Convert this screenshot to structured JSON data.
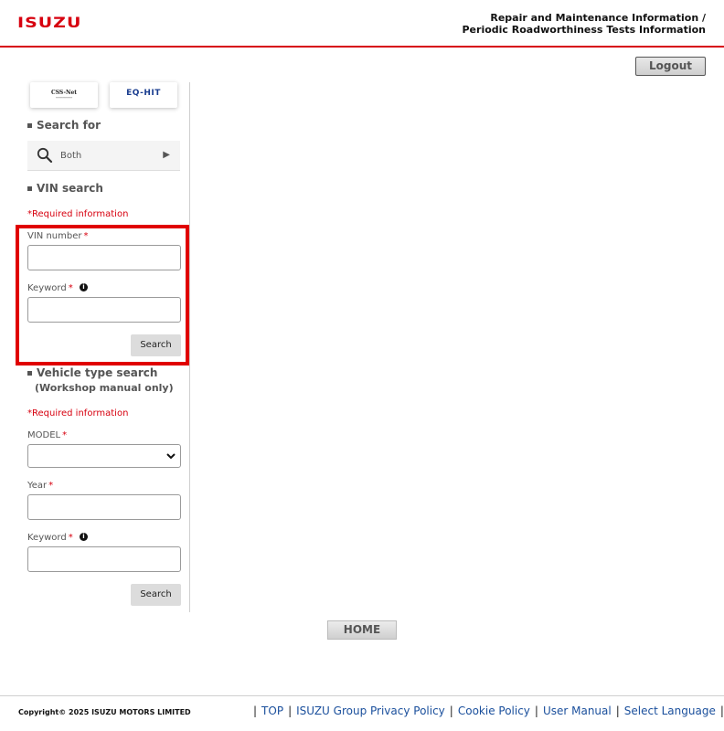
{
  "header": {
    "logo_text": "ISUZU",
    "title_line1": "Repair and Maintenance Information /",
    "title_line2": "Periodic Roadworthiness Tests Information"
  },
  "logout_label": "Logout",
  "banners": {
    "css_net": "CSS-Net",
    "eq_hit": "EQ-HIT"
  },
  "search_for": {
    "heading": "Search for",
    "value": "Both"
  },
  "vin_search": {
    "heading": "VIN search",
    "required_note": "*Required information",
    "vin_label": "VIN number",
    "keyword_label": "Keyword",
    "required_mark": "*",
    "search_label": "Search"
  },
  "vehicle_search": {
    "heading": "Vehicle type search",
    "subheading": "(Workshop manual only)",
    "required_note": "*Required information",
    "model_label": "MODEL",
    "year_label": "Year",
    "keyword_label": "Keyword",
    "required_mark": "*",
    "search_label": "Search"
  },
  "home_label": "HOME",
  "footer": {
    "copyright": "Copyright© 2025 ISUZU MOTORS LIMITED",
    "separator": "|",
    "links": [
      "TOP",
      "ISUZU Group Privacy Policy",
      "Cookie Policy",
      "User Manual",
      "Select Language"
    ]
  },
  "colors": {
    "brand_red": "#d7000f",
    "highlight_red": "#e00000",
    "link_blue": "#1a4f9c"
  }
}
